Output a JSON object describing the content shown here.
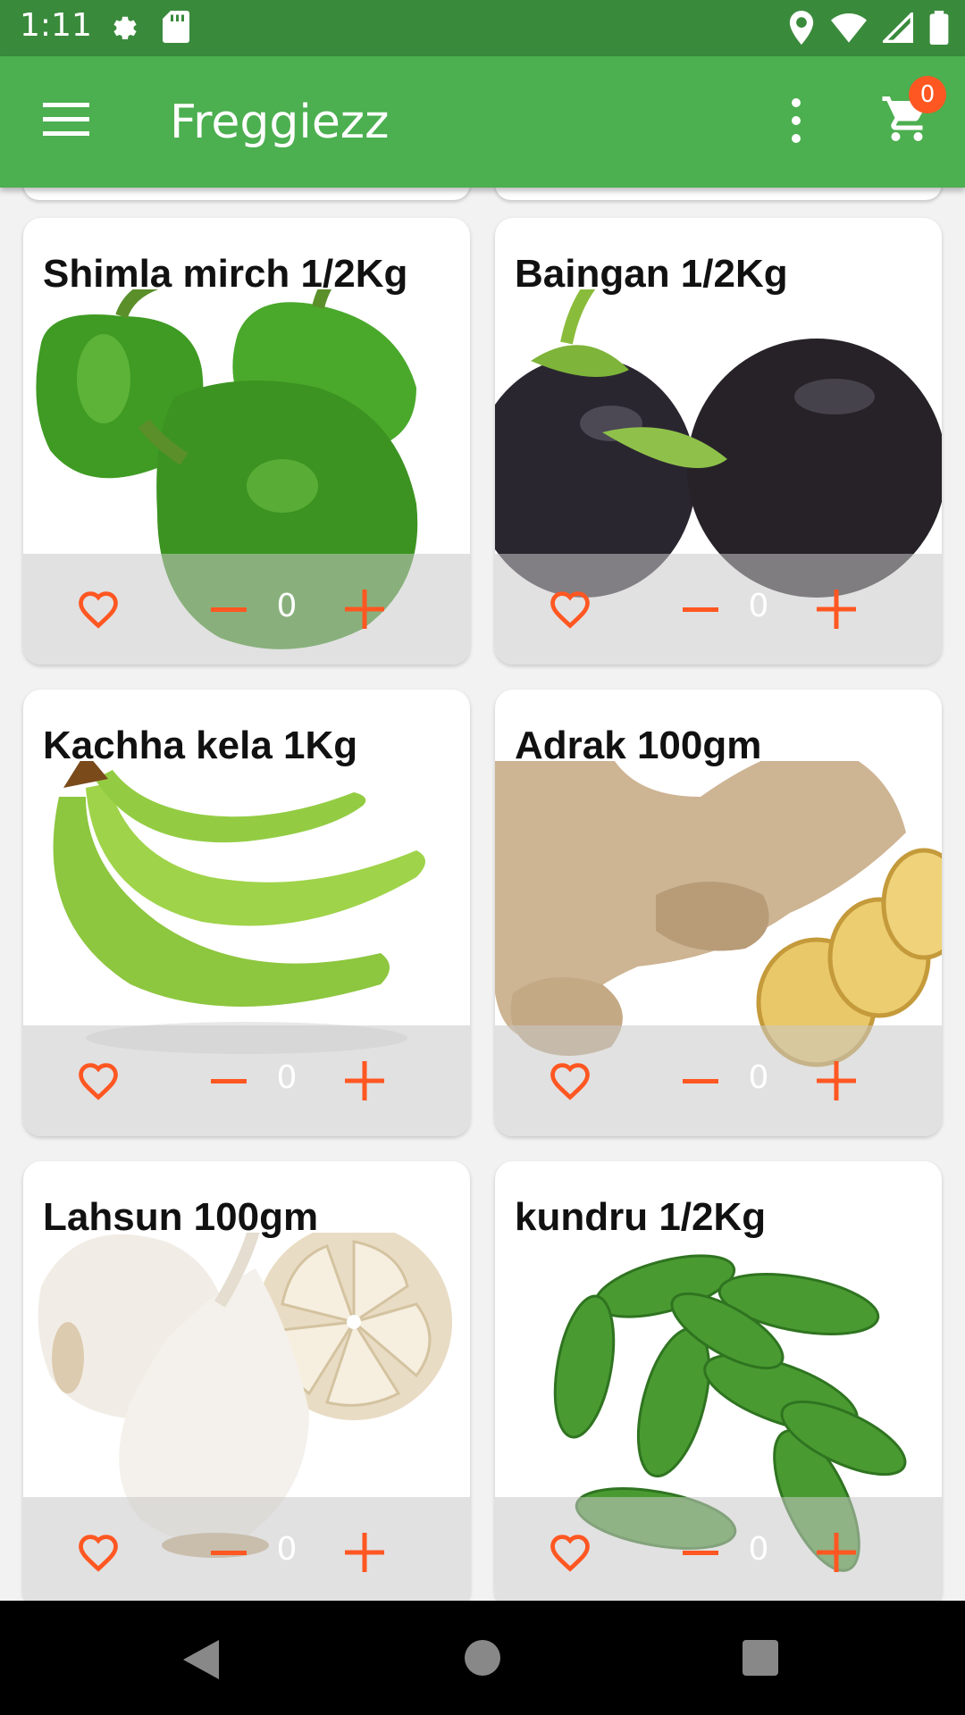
{
  "status_bar": {
    "time": "1:11"
  },
  "app_bar": {
    "title": "Freggiezz",
    "cart_count": "0"
  },
  "products": [
    {
      "name": "Shimla mirch 1/2Kg",
      "qty": "0",
      "image": "green-bell-pepper"
    },
    {
      "name": "Baingan 1/2Kg",
      "qty": "0",
      "image": "eggplant"
    },
    {
      "name": "Kachha kela 1Kg",
      "qty": "0",
      "image": "green-banana"
    },
    {
      "name": "Adrak 100gm",
      "qty": "0",
      "image": "ginger"
    },
    {
      "name": "Lahsun 100gm",
      "qty": "0",
      "image": "garlic"
    },
    {
      "name": "kundru 1/2Kg",
      "qty": "0",
      "image": "ivy-gourd"
    }
  ],
  "colors": {
    "status_bar": "#3a8a3c",
    "app_bar": "#4caf50",
    "accent": "#ff5722",
    "badge": "#ff5722"
  }
}
